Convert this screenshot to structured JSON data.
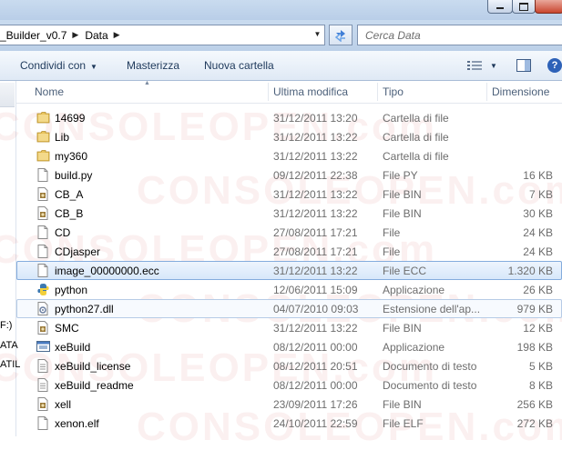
{
  "address": {
    "crumbs": [
      "_Builder_v0.7",
      "Data"
    ],
    "dropdown_icon": "chevron-down-icon",
    "refresh_icon": "refresh-icon"
  },
  "search": {
    "placeholder": "Cerca Data"
  },
  "toolbar": {
    "share_label": "Condividi con",
    "burn_label": "Masterizza",
    "new_folder_label": "Nuova cartella",
    "help_label": "?"
  },
  "nav": {
    "labels": [
      "F:)",
      "ATA",
      "ATIL"
    ]
  },
  "columns": {
    "name": "Nome",
    "modified": "Ultima modifica",
    "type": "Tipo",
    "size": "Dimensione"
  },
  "files": [
    {
      "name": "14699",
      "date": "31/12/2011 13:20",
      "type": "Cartella di file",
      "size": "",
      "icon": "folder-icon"
    },
    {
      "name": "Lib",
      "date": "31/12/2011 13:22",
      "type": "Cartella di file",
      "size": "",
      "icon": "folder-icon"
    },
    {
      "name": "my360",
      "date": "31/12/2011 13:22",
      "type": "Cartella di file",
      "size": "",
      "icon": "folder-icon"
    },
    {
      "name": "build.py",
      "date": "09/12/2011 22:38",
      "type": "File PY",
      "size": "16 KB",
      "icon": "blank-file-icon"
    },
    {
      "name": "CB_A",
      "date": "31/12/2011 13:22",
      "type": "File BIN",
      "size": "7 KB",
      "icon": "bin-file-icon"
    },
    {
      "name": "CB_B",
      "date": "31/12/2011 13:22",
      "type": "File BIN",
      "size": "30 KB",
      "icon": "bin-file-icon"
    },
    {
      "name": "CD",
      "date": "27/08/2011 17:21",
      "type": "File",
      "size": "24 KB",
      "icon": "blank-file-icon"
    },
    {
      "name": "CDjasper",
      "date": "27/08/2011 17:21",
      "type": "File",
      "size": "24 KB",
      "icon": "blank-file-icon"
    },
    {
      "name": "image_00000000.ecc",
      "date": "31/12/2011 13:22",
      "type": "File ECC",
      "size": "1.320 KB",
      "icon": "blank-file-icon"
    },
    {
      "name": "python",
      "date": "12/06/2011 15:09",
      "type": "Applicazione",
      "size": "26 KB",
      "icon": "python-icon"
    },
    {
      "name": "python27.dll",
      "date": "04/07/2010 09:03",
      "type": "Estensione dell'ap...",
      "size": "979 KB",
      "icon": "dll-file-icon"
    },
    {
      "name": "SMC",
      "date": "31/12/2011 13:22",
      "type": "File BIN",
      "size": "12 KB",
      "icon": "bin-file-icon"
    },
    {
      "name": "xeBuild",
      "date": "08/12/2011 00:00",
      "type": "Applicazione",
      "size": "198 KB",
      "icon": "application-icon"
    },
    {
      "name": "xeBuild_license",
      "date": "08/12/2011 20:51",
      "type": "Documento di testo",
      "size": "5 KB",
      "icon": "text-file-icon"
    },
    {
      "name": "xeBuild_readme",
      "date": "08/12/2011 00:00",
      "type": "Documento di testo",
      "size": "8 KB",
      "icon": "text-file-icon"
    },
    {
      "name": "xell",
      "date": "23/09/2011 17:26",
      "type": "File BIN",
      "size": "256 KB",
      "icon": "bin-file-icon"
    },
    {
      "name": "xenon.elf",
      "date": "24/10/2011 22:59",
      "type": "File ELF",
      "size": "272 KB",
      "icon": "blank-file-icon"
    }
  ],
  "selected_index": 8,
  "hover_index": 10,
  "watermark": "CONSOLEOPEN.com",
  "colors": {
    "chrome": "#c9dbef",
    "toolbar_text": "#1e395b",
    "header_text": "#4c607a",
    "folder": "#e8c35c",
    "selection": "#d6e7fa"
  }
}
